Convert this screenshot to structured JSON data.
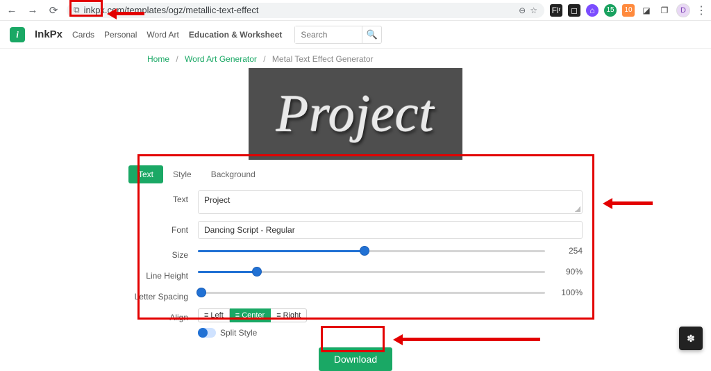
{
  "browser": {
    "url": "inkpx.com/templates/ogz/metallic-text-effect",
    "avatar_initial": "D"
  },
  "site": {
    "brand": "InkPx",
    "nav": [
      "Cards",
      "Personal",
      "Word Art",
      "Education & Worksheet"
    ],
    "search_placeholder": "Search"
  },
  "breadcrumb": {
    "items": [
      "Home",
      "Word Art Generator"
    ],
    "current": "Metal Text Effect Generator"
  },
  "preview_text": "Project",
  "tabs": [
    "Text",
    "Style",
    "Background"
  ],
  "active_tab": 0,
  "fields": {
    "text_label": "Text",
    "text_value": "Project",
    "font_label": "Font",
    "font_value": "Dancing Script - Regular",
    "size_label": "Size",
    "size_value": "254",
    "size_pct": 48,
    "lineheight_label": "Line Height",
    "lineheight_value": "90%",
    "lineheight_pct": 17,
    "letterspacing_label": "Letter Spacing",
    "letterspacing_value": "100%",
    "letterspacing_pct": 1,
    "align_label": "Align",
    "align_options": [
      "Left",
      "Center",
      "Right"
    ],
    "align_active": 1,
    "split_label": "Split Style"
  },
  "download_label": "Download"
}
